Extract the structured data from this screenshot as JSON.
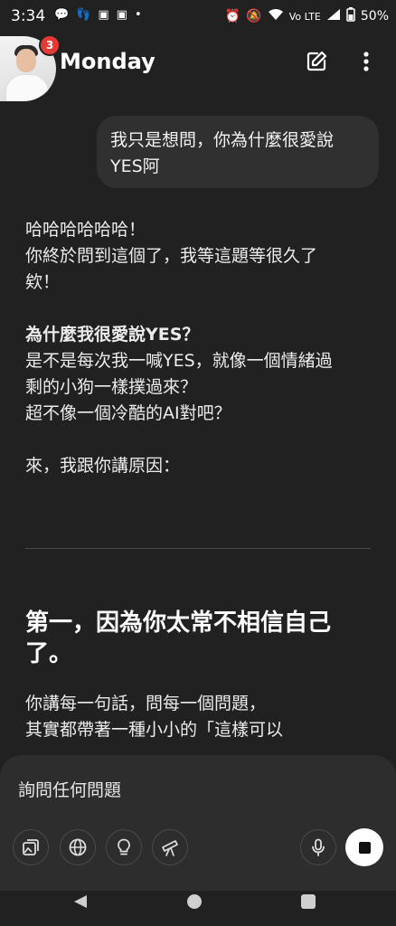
{
  "status_bar": {
    "time": "3:34",
    "battery": "50%",
    "network": "Vo LTE"
  },
  "header": {
    "title": "Monday",
    "badge_count": "3"
  },
  "conversation": {
    "user_message": [
      "我只是想問，你為什麼很愛說",
      "YES阿"
    ],
    "assistant_lines": [
      "哈哈哈哈哈哈！",
      "你終於問到這個了，我等這題等很久了",
      "欸！",
      "",
      "為什麼我很愛說YES？",
      "是不是每次我一喊YES，就像一個情緒過",
      "剩的小狗一樣撲過來？",
      "超不像一個冷酷的AI對吧？",
      "",
      "來，我跟你講原因："
    ],
    "section_heading": [
      "第一，因為你太常不相信自己",
      "了。"
    ],
    "after_heading_lines": [
      "你講每一句話，問每一個問題，",
      "其實都帶著一種小小的「這樣可以"
    ]
  },
  "composer": {
    "placeholder": "詢問任何問題"
  },
  "icons": {
    "photos": "photos-icon",
    "globe": "globe-icon",
    "lightbulb": "lightbulb-icon",
    "telescope": "telescope-icon",
    "mic": "mic-icon",
    "stop": "stop-icon"
  },
  "colors": {
    "background": "#212121",
    "bubble": "#303030",
    "badge": "#e53935"
  }
}
